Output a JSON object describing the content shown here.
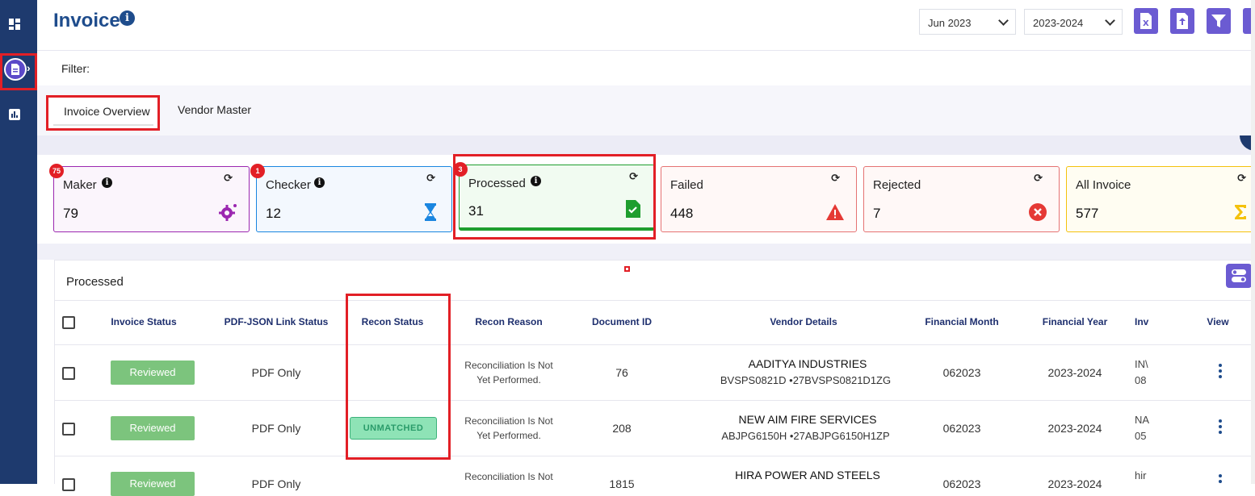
{
  "header": {
    "title": "Invoice",
    "month_select": "Jun 2023",
    "year_select": "2023-2024"
  },
  "filter": {
    "label": "Filter:"
  },
  "tabs": [
    {
      "label": "Invoice Overview",
      "active": true
    },
    {
      "label": "Vendor Master",
      "active": false
    }
  ],
  "cards": {
    "maker": {
      "label": "Maker",
      "value": "79",
      "badge": "75",
      "color": "#9b27b0"
    },
    "checker": {
      "label": "Checker",
      "value": "12",
      "badge": "1",
      "color": "#1a86e0"
    },
    "processed": {
      "label": "Processed",
      "value": "31",
      "badge": "3",
      "color": "#1e9e2e"
    },
    "failed": {
      "label": "Failed",
      "value": "448",
      "color": "#e53935"
    },
    "rejected": {
      "label": "Rejected",
      "value": "7",
      "color": "#e53935"
    },
    "all": {
      "label": "All Invoice",
      "value": "577",
      "color": "#f4c20d"
    }
  },
  "panel": {
    "title": "Processed"
  },
  "table": {
    "headers": {
      "invoice_status": "Invoice Status",
      "pdf_json": "PDF-JSON Link Status",
      "recon_status": "Recon Status",
      "recon_reason": "Recon Reason",
      "document_id": "Document ID",
      "vendor_details": "Vendor Details",
      "financial_month": "Financial Month",
      "financial_year": "Financial Year",
      "inv": "Inv",
      "view": "View"
    },
    "rows": [
      {
        "status": "Reviewed",
        "pdf": "PDF Only",
        "recon": "",
        "reason_line1": "Reconciliation Is Not",
        "reason_line2": "Yet Performed.",
        "doc_id": "76",
        "vendor_name": "AADITYA INDUSTRIES",
        "vendor_ids": "BVSPS0821D  •27BVSPS0821D1ZG",
        "month": "062023",
        "year": "2023-2024",
        "inv_line1": "IN\\",
        "inv_line2": "08"
      },
      {
        "status": "Reviewed",
        "pdf": "PDF Only",
        "recon": "UNMATCHED",
        "reason_line1": "Reconciliation Is Not",
        "reason_line2": "Yet Performed.",
        "doc_id": "208",
        "vendor_name": "NEW AIM FIRE SERVICES",
        "vendor_ids": "ABJPG6150H  •27ABJPG6150H1ZP",
        "month": "062023",
        "year": "2023-2024",
        "inv_line1": "NA",
        "inv_line2": "05"
      },
      {
        "status": "Reviewed",
        "pdf": "PDF Only",
        "recon": "",
        "reason_line1": "Reconciliation Is Not",
        "reason_line2": "",
        "doc_id": "1815",
        "vendor_name": "HIRA POWER AND STEELS",
        "vendor_ids": "",
        "month": "062023",
        "year": "2023-2024",
        "inv_line1": "hir",
        "inv_line2": ""
      }
    ]
  },
  "colors": {
    "rail": "#1e3a6e",
    "accent": "#6b5bd2",
    "highlight": "#e21f26",
    "reviewed": "#7cc47d"
  }
}
